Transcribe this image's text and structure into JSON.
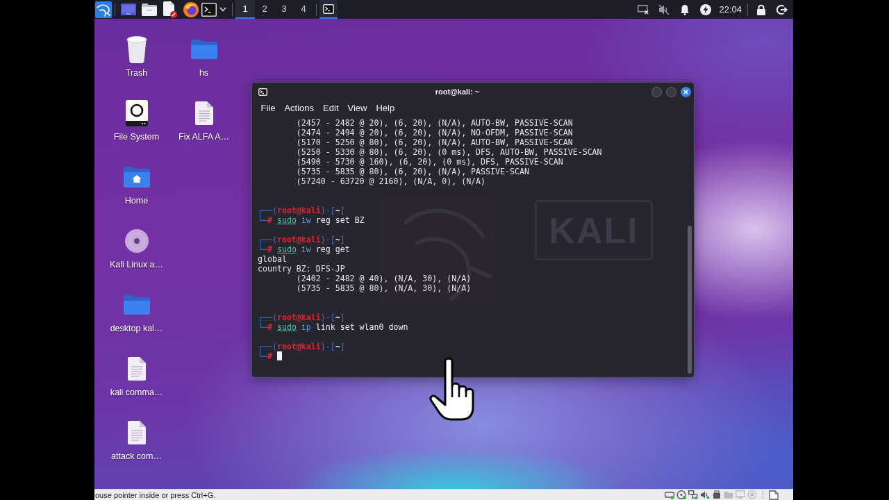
{
  "taskbar": {
    "workspaces": [
      {
        "label": "1",
        "selected": true
      },
      {
        "label": "2",
        "selected": false
      },
      {
        "label": "3",
        "selected": false
      },
      {
        "label": "4",
        "selected": false
      }
    ],
    "windows": [
      {
        "selected": true
      }
    ],
    "volume_muted": true,
    "clock": "22:04"
  },
  "desktop_icons": [
    {
      "label": "Trash",
      "kind": "trash"
    },
    {
      "label": "File System",
      "kind": "drive"
    },
    {
      "label": "Home",
      "kind": "home"
    },
    {
      "label": "Kali Linux a…",
      "kind": "disc"
    },
    {
      "label": "desktop kal…",
      "kind": "folder"
    },
    {
      "label": "kali comma…",
      "kind": "document"
    },
    {
      "label": "attack com…",
      "kind": "document"
    },
    {
      "label": "hs",
      "kind": "folder"
    },
    {
      "label": "Fix ALFA A…",
      "kind": "document"
    }
  ],
  "terminal": {
    "title": "root@kali: ~",
    "menu": [
      "File",
      "Actions",
      "Edit",
      "View",
      "Help"
    ],
    "background_logo": "KALI",
    "lines": [
      {
        "kind": "detail",
        "text": "(2457 - 2482 @ 20), (6, 20), (N/A), AUTO-BW, PASSIVE-SCAN"
      },
      {
        "kind": "detail",
        "text": "(2474 - 2494 @ 20), (6, 20), (N/A), NO-OFDM, PASSIVE-SCAN"
      },
      {
        "kind": "detail",
        "text": "(5170 - 5250 @ 80), (6, 20), (N/A), AUTO-BW, PASSIVE-SCAN"
      },
      {
        "kind": "detail",
        "text": "(5250 - 5330 @ 80), (6, 20), (0 ms), DFS, AUTO-BW, PASSIVE-SCAN"
      },
      {
        "kind": "detail",
        "text": "(5490 - 5730 @ 160), (6, 20), (0 ms), DFS, PASSIVE-SCAN"
      },
      {
        "kind": "detail",
        "text": "(5735 - 5835 @ 80), (6, 20), (N/A), PASSIVE-SCAN"
      },
      {
        "kind": "detail",
        "text": "(57240 - 63720 @ 2160), (N/A, 0), (N/A)"
      },
      {
        "kind": "blank"
      },
      {
        "kind": "blank"
      },
      {
        "kind": "prompt",
        "parts": [
          "┌──(",
          "root@kali",
          ")-[",
          "~",
          "]"
        ]
      },
      {
        "kind": "command",
        "parts": [
          "└─",
          "# ",
          "sudo",
          " iw",
          " reg set BZ"
        ]
      },
      {
        "kind": "blank"
      },
      {
        "kind": "prompt",
        "parts": [
          "┌──(",
          "root@kali",
          ")-[",
          "~",
          "]"
        ]
      },
      {
        "kind": "command",
        "parts": [
          "└─",
          "# ",
          "sudo",
          " iw",
          " reg get"
        ]
      },
      {
        "kind": "output",
        "text": "global"
      },
      {
        "kind": "output",
        "text": "country BZ: DFS-JP"
      },
      {
        "kind": "detail",
        "text": "(2402 - 2482 @ 40), (N/A, 30), (N/A)"
      },
      {
        "kind": "detail",
        "text": "(5735 - 5835 @ 80), (N/A, 30), (N/A)"
      },
      {
        "kind": "blank"
      },
      {
        "kind": "blank"
      },
      {
        "kind": "prompt",
        "parts": [
          "┌──(",
          "root@kali",
          ")-[",
          "~",
          "]"
        ]
      },
      {
        "kind": "command",
        "parts": [
          "└─",
          "# ",
          "sudo",
          " ip",
          " link set wlan0 down"
        ]
      },
      {
        "kind": "blank"
      },
      {
        "kind": "prompt",
        "parts": [
          "┌──(",
          "root@kali",
          ")-[",
          "~",
          "]"
        ]
      },
      {
        "kind": "command",
        "parts": [
          "└─",
          "# "
        ],
        "cursor": true
      }
    ]
  },
  "status_bar": {
    "message": "ouse pointer inside or press Ctrl+G.",
    "indicators": [
      {
        "kind": "hard-disk",
        "active": true
      },
      {
        "kind": "optical-disc",
        "active": true
      },
      {
        "kind": "network",
        "active": true
      },
      {
        "kind": "audio",
        "active": true
      },
      {
        "kind": "usb",
        "active": true
      },
      {
        "kind": "shared-folders",
        "active": false
      },
      {
        "kind": "display",
        "active": false
      },
      {
        "kind": "recording",
        "active": false
      }
    ]
  }
}
